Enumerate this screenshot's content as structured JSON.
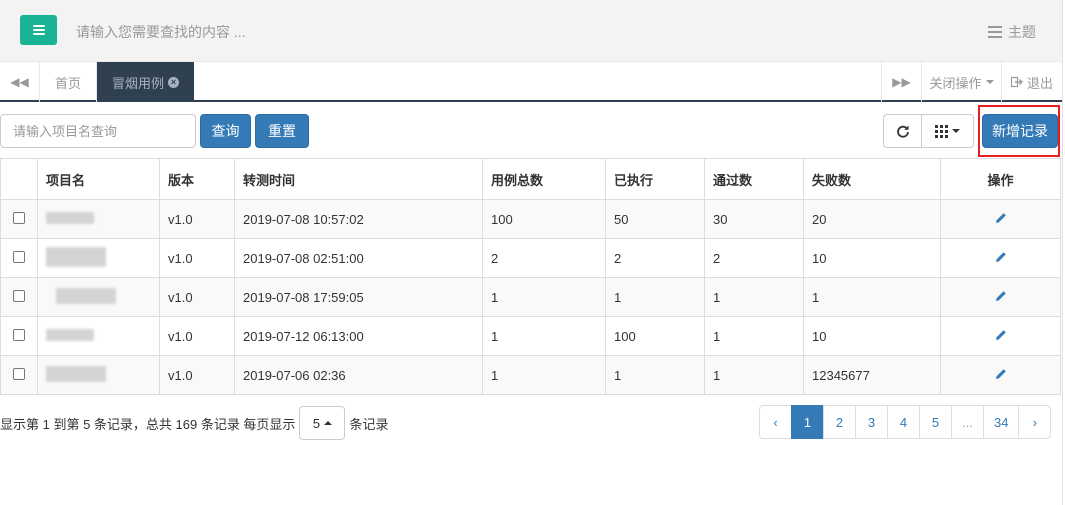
{
  "header": {
    "search_placeholder": "请输入您需要查找的内容 ...",
    "theme_label": "主题"
  },
  "tabs": {
    "home_label": "首页",
    "active_label": "冒烟用例",
    "close_ops_label": "关闭操作",
    "logout_label": "退出"
  },
  "toolbar": {
    "search_placeholder": "请输入项目名查询",
    "query_label": "查询",
    "reset_label": "重置",
    "add_label": "新增记录"
  },
  "table": {
    "headers": [
      "项目名",
      "版本",
      "转测时间",
      "用例总数",
      "已执行",
      "通过数",
      "失败数",
      "操作"
    ],
    "rows": [
      {
        "version": "v1.0",
        "time": "2019-07-08 10:57:02",
        "total": "100",
        "executed": "50",
        "passed": "30",
        "failed": "20"
      },
      {
        "version": "v1.0",
        "time": "2019-07-08 02:51:00",
        "total": "2",
        "executed": "2",
        "passed": "2",
        "failed": "10"
      },
      {
        "version": "v1.0",
        "time": "2019-07-08 17:59:05",
        "total": "1",
        "executed": "1",
        "passed": "1",
        "failed": "1"
      },
      {
        "version": "v1.0",
        "time": "2019-07-12 06:13:00",
        "total": "1",
        "executed": "100",
        "passed": "1",
        "failed": "10"
      },
      {
        "version": "v1.0",
        "time": "2019-07-06 02:36",
        "total": "1",
        "executed": "1",
        "passed": "1",
        "failed": "12345677"
      }
    ]
  },
  "footer": {
    "info_prefix": "显示第 1 到第 5 条记录，总共 169 条记录 每页显示",
    "page_size": "5",
    "info_suffix": "条记录"
  },
  "pagination": {
    "prev": "‹",
    "pages": [
      "1",
      "2",
      "3",
      "4",
      "5",
      "...",
      "34"
    ],
    "next": "›",
    "active": "1"
  },
  "colors": {
    "accent_green": "#1ab394",
    "primary_blue": "#337ab7",
    "tab_dark": "#2f4050",
    "highlight_red": "#e62020"
  }
}
